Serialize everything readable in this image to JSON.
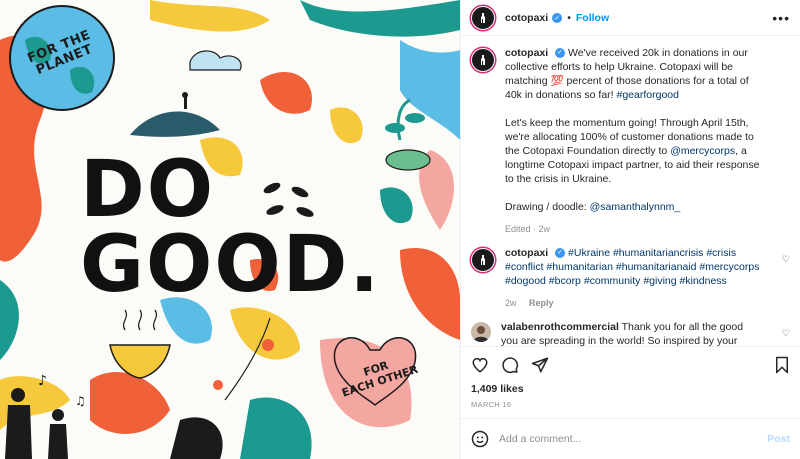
{
  "header": {
    "username": "cotopaxi",
    "follow_label": "Follow",
    "more_label": "•••"
  },
  "artwork": {
    "headline_line1": "DO",
    "headline_line2": "GOOD.",
    "badge_planet": "FOR THE PLANET",
    "badge_other_line1": "FOR",
    "badge_other_line2": "EACH OTHER",
    "palette": {
      "orange": "#f0613a",
      "teal": "#1d9a90",
      "yellow": "#f6c93c",
      "blue": "#5bbde6",
      "pink": "#f3a7a0",
      "dark": "#1b1b1b"
    }
  },
  "caption": {
    "username": "cotopaxi",
    "p1_a": "We've received 20k in donations in our collective efforts to help Ukraine. Cotopaxi will be matching ",
    "p1_emoji": "💯",
    "p1_b": " percent of those donations for a total of 40k in donations so far!",
    "p1_tag": "#gearforgood",
    "p2_a": "Let's keep the momentum going! Through April 15th, we're allocating 100% of customer donations made to the Cotopaxi Foundation directly to ",
    "p2_mention": "@mercycorps",
    "p2_b": ", a longtime Cotopaxi impact partner, to aid their response to the crisis in Ukraine.",
    "p3_a": "Drawing / doodle: ",
    "p3_mention": "@samanthalynnm_",
    "meta_edited": "Edited",
    "meta_time": "2w"
  },
  "comment1": {
    "username": "cotopaxi",
    "text": "#Ukraine #humanitariancrisis #crisis #conflict #humanitarian #humanitarianaid #mercycorps #dogood #bcorp #community #giving #kindness",
    "time": "2w",
    "reply": "Reply"
  },
  "comment2": {
    "username": "valabenrothcommercial",
    "text": "Thank you for all the good you are spreading in the world! So inspired by your company!"
  },
  "footer": {
    "likes": "1,409 likes",
    "date": "MARCH 16",
    "add_placeholder": "Add a comment...",
    "post_label": "Post"
  }
}
